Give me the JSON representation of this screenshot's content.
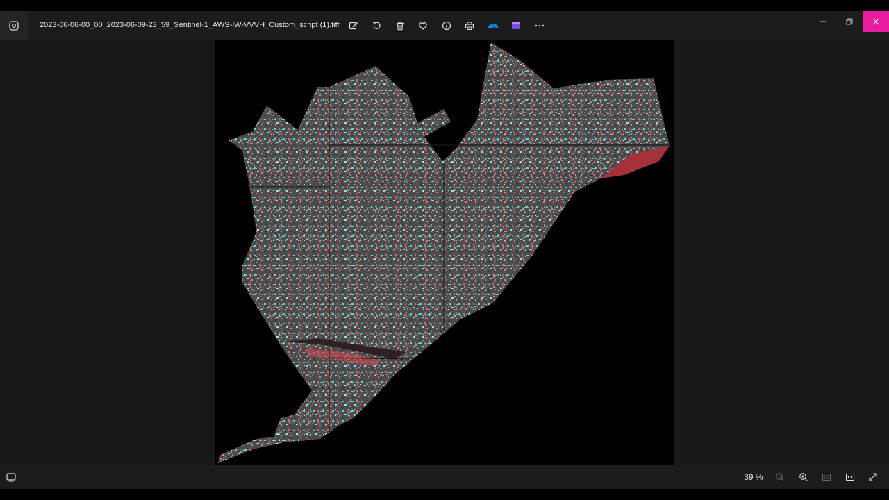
{
  "window": {
    "title": "2023-06-06-00_00_2023-06-09-23_59_Sentinel-1_AWS-IW-VVVH_Custom_script (1).tiff",
    "accent_close": "#e81ca0"
  },
  "toolbar": {
    "items": [
      {
        "name": "edit-image",
        "icon": "edit-icon"
      },
      {
        "name": "rotate",
        "icon": "rotate-icon"
      },
      {
        "name": "delete",
        "icon": "trash-icon"
      },
      {
        "name": "favorite",
        "icon": "heart-icon"
      },
      {
        "name": "file-info",
        "icon": "info-icon"
      },
      {
        "name": "print",
        "icon": "print-icon"
      },
      {
        "name": "onedrive",
        "icon": "cloud-icon"
      },
      {
        "name": "clipchamp",
        "icon": "clipchamp-icon"
      },
      {
        "name": "more-options",
        "icon": "ellipsis-icon"
      }
    ]
  },
  "window_controls": {
    "minimize": "—",
    "restore": "❐",
    "close": "✕"
  },
  "status": {
    "zoom_level": "39 %"
  }
}
